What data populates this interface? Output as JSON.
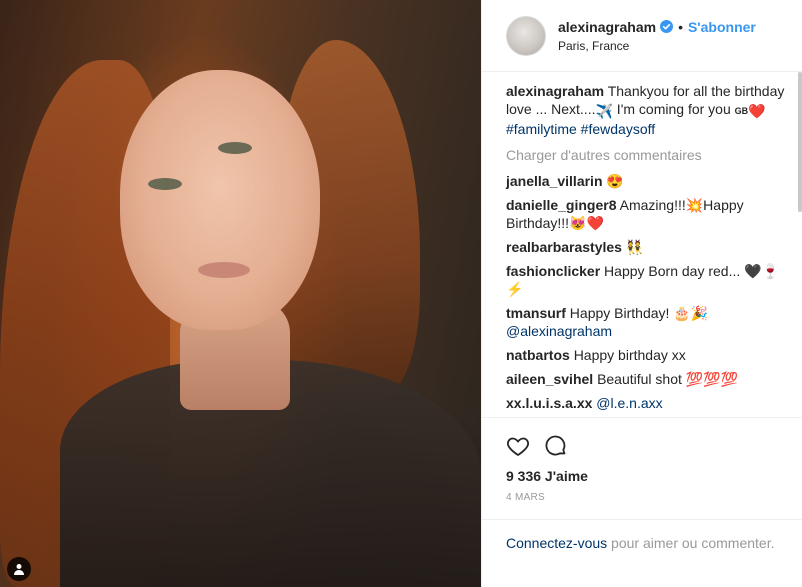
{
  "post": {
    "user_tag_icon": "person-icon",
    "header": {
      "username": "alexinagraham",
      "verified_icon": "verified-badge-icon",
      "separator": "•",
      "follow_label": "S'abonner",
      "location": "Paris, France"
    },
    "caption": {
      "username": "alexinagraham",
      "text_part1": "Thankyou for all the birthday love ... Next....",
      "emoji_plane": "✈️",
      "text_part2": " I'm coming for you ",
      "flag": "GB",
      "emoji_heart": "❤️",
      "hashtags": "#familytime #fewdaysoff"
    },
    "load_more_label": "Charger d'autres commentaires",
    "comments": [
      {
        "user": "janella_villarin",
        "text": "😍"
      },
      {
        "user": "danielle_ginger8",
        "text": "Amazing!!!💥Happy Birthday!!!😻❤️"
      },
      {
        "user": "realbarbarastyles",
        "text": "👯"
      },
      {
        "user": "fashionclicker",
        "text": "Happy Born day red... 🖤🍷⚡"
      },
      {
        "user": "tmansurf",
        "text": "Happy Birthday! 🎂🎉",
        "mention": "@alexinagraham"
      },
      {
        "user": "natbartos",
        "text": "Happy birthday xx"
      },
      {
        "user": "aileen_svihel",
        "text": "Beautiful shot 💯💯💯"
      },
      {
        "user": "xx.l.u.i.s.a.xx",
        "text": "",
        "mention": "@l.e.n.axx"
      }
    ],
    "actions": {
      "like_icon": "heart-outline-icon",
      "comment_icon": "comment-bubble-icon"
    },
    "likes": "9 336 J'aime",
    "date": "4 MARS",
    "login": {
      "link_label": "Connectez-vous",
      "rest": " pour aimer ou commenter."
    },
    "colors": {
      "link_blue": "#3897f0",
      "dark_link": "#003569",
      "muted": "#999999"
    }
  }
}
